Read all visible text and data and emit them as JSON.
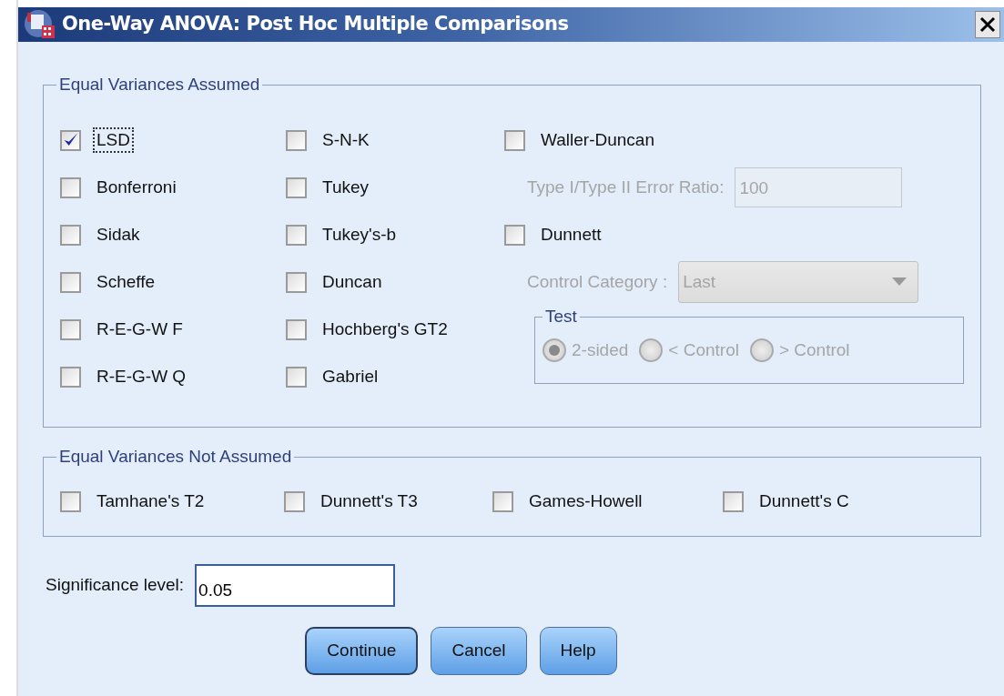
{
  "window": {
    "title": "One-Way ANOVA: Post Hoc Multiple Comparisons"
  },
  "equal_variances_assumed": {
    "legend": "Equal Variances Assumed",
    "options": [
      {
        "label": "LSD",
        "checked": true,
        "focused": true
      },
      {
        "label": "S-N-K",
        "checked": false
      },
      {
        "label": "Bonferroni",
        "checked": false
      },
      {
        "label": "Tukey",
        "checked": false
      },
      {
        "label": "Sidak",
        "checked": false
      },
      {
        "label": "Tukey's-b",
        "checked": false
      },
      {
        "label": "Scheffe",
        "checked": false
      },
      {
        "label": "Duncan",
        "checked": false
      },
      {
        "label": "R-E-G-W F",
        "checked": false
      },
      {
        "label": "Hochberg's GT2",
        "checked": false
      },
      {
        "label": "R-E-G-W Q",
        "checked": false
      },
      {
        "label": "Gabriel",
        "checked": false
      }
    ],
    "waller_duncan": {
      "label": "Waller-Duncan",
      "checked": false
    },
    "error_ratio": {
      "label": "Type I/Type II Error Ratio:",
      "value": "100",
      "disabled": true
    },
    "dunnett": {
      "label": "Dunnett",
      "checked": false
    },
    "control_category": {
      "label": "Control Category :",
      "value": "Last",
      "disabled": true
    },
    "test": {
      "legend": "Test",
      "options": [
        {
          "label": "2-sided",
          "selected": true,
          "disabled": true
        },
        {
          "label": "< Control",
          "selected": false,
          "disabled": true
        },
        {
          "label": "> Control",
          "selected": false,
          "disabled": true
        }
      ]
    }
  },
  "equal_variances_not_assumed": {
    "legend": "Equal Variances Not Assumed",
    "options": [
      {
        "label": "Tamhane's T2",
        "checked": false
      },
      {
        "label": "Dunnett's T3",
        "checked": false
      },
      {
        "label": "Games-Howell",
        "checked": false
      },
      {
        "label": "Dunnett's C",
        "checked": false
      }
    ]
  },
  "significance_level": {
    "label": "Significance level:",
    "value": "0.05"
  },
  "buttons": [
    {
      "label": "Continue",
      "focused": true
    },
    {
      "label": "Cancel",
      "focused": false
    },
    {
      "label": "Help",
      "focused": false
    }
  ]
}
